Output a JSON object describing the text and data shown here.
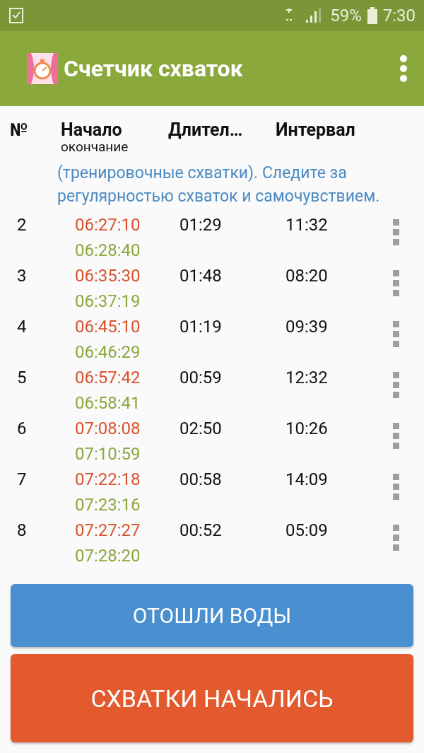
{
  "status_bar": {
    "battery": "59%",
    "time": "7:30"
  },
  "app_bar": {
    "title": "Счетчик схваток"
  },
  "table": {
    "columns": [
      {
        "label": "№"
      },
      {
        "label": "Начало",
        "sublabel": "окончание"
      },
      {
        "label": "Длител…"
      },
      {
        "label": "Интервал"
      }
    ],
    "note": "(тренировочные схватки). Следите за регулярностью схваток и самочувствием.",
    "rows": [
      {
        "number": "2",
        "start": "06:27:10",
        "end": "06:28:40",
        "duration": "01:29",
        "interval": "11:32"
      },
      {
        "number": "3",
        "start": "06:35:30",
        "end": "06:37:19",
        "duration": "01:48",
        "interval": "08:20"
      },
      {
        "number": "4",
        "start": "06:45:10",
        "end": "06:46:29",
        "duration": "01:19",
        "interval": "09:39"
      },
      {
        "number": "5",
        "start": "06:57:42",
        "end": "06:58:41",
        "duration": "00:59",
        "interval": "12:32"
      },
      {
        "number": "6",
        "start": "07:08:08",
        "end": "07:10:59",
        "duration": "02:50",
        "interval": "10:26"
      },
      {
        "number": "7",
        "start": "07:22:18",
        "end": "07:23:16",
        "duration": "00:58",
        "interval": "14:09"
      },
      {
        "number": "8",
        "start": "07:27:27",
        "end": "07:28:20",
        "duration": "00:52",
        "interval": "05:09"
      }
    ]
  },
  "buttons": [
    {
      "label": "ОТОШЛИ ВОДЫ",
      "kind": "secondary"
    },
    {
      "label": "СХВАТКИ НАЧАЛИСЬ",
      "kind": "primary"
    }
  ]
}
